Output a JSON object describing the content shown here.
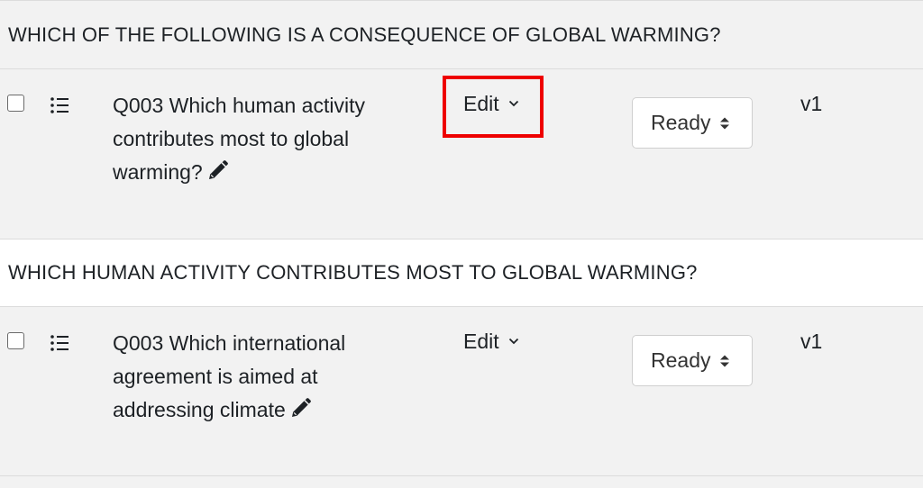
{
  "sections": [
    {
      "title": "WHICH OF THE FOLLOWING IS A CONSEQUENCE OF GLOBAL WARMING?",
      "question": {
        "text": "Q003 Which human activity contributes most to global warming?",
        "action_label": "Edit",
        "status": "Ready",
        "version": "v1",
        "highlighted": true
      }
    },
    {
      "title": "WHICH HUMAN ACTIVITY CONTRIBUTES MOST TO GLOBAL WARMING?",
      "question": {
        "text": "Q003 Which international agreement is aimed at addressing climate",
        "action_label": "Edit",
        "status": "Ready",
        "version": "v1",
        "highlighted": false
      }
    }
  ],
  "colors": {
    "highlight": "#ee0000",
    "row_background": "#f2f2f2",
    "header_alt_background": "#ffffff"
  },
  "icons": {
    "drag": "list-drag-icon",
    "edit_question": "pencil-icon",
    "menu_caret": "chevron-down-icon",
    "select_caret": "sort-updown-icon"
  }
}
